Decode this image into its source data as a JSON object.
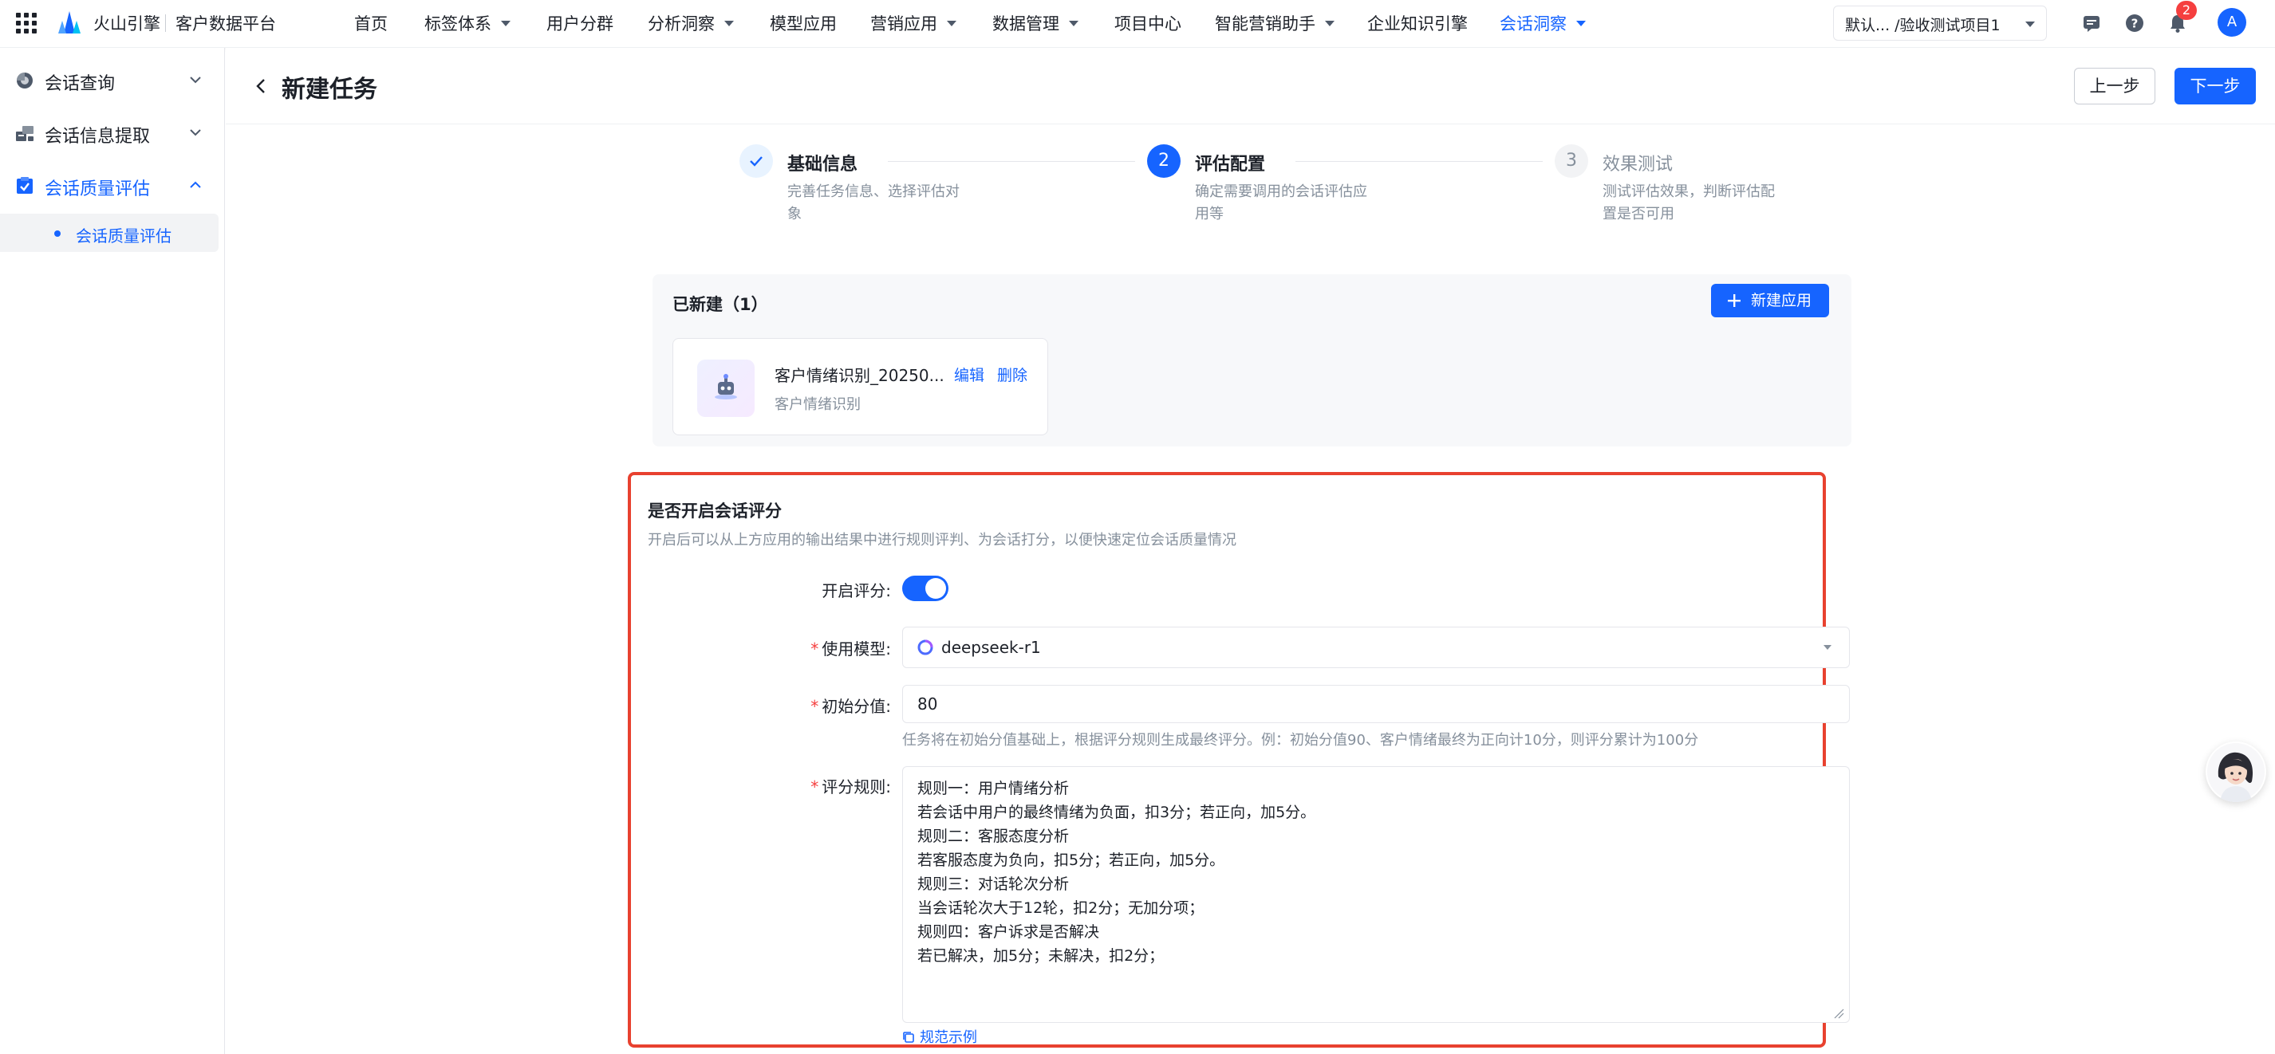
{
  "topnav": {
    "brand": "火山引擎",
    "platform": "客户数据平台",
    "items": [
      {
        "label": "首页",
        "has_caret": false
      },
      {
        "label": "标签体系",
        "has_caret": true
      },
      {
        "label": "用户分群",
        "has_caret": false
      },
      {
        "label": "分析洞察",
        "has_caret": true
      },
      {
        "label": "模型应用",
        "has_caret": false
      },
      {
        "label": "营销应用",
        "has_caret": true
      },
      {
        "label": "数据管理",
        "has_caret": true
      },
      {
        "label": "项目中心",
        "has_caret": false
      },
      {
        "label": "智能营销助手",
        "has_caret": true
      },
      {
        "label": "企业知识引擎",
        "has_caret": false
      },
      {
        "label": "会话洞察",
        "has_caret": true,
        "active": true
      }
    ],
    "project": "默认...   /验收测试项目1",
    "notification_count": "2",
    "avatar_initial": "A"
  },
  "sidebar": {
    "groups": [
      {
        "label": "会话查询",
        "expanded": false
      },
      {
        "label": "会话信息提取",
        "expanded": false
      },
      {
        "label": "会话质量评估",
        "expanded": true,
        "active": true
      }
    ],
    "sub_item": "会话质量评估"
  },
  "header": {
    "title": "新建任务",
    "prev_label": "上一步",
    "next_label": "下一步"
  },
  "steps": [
    {
      "number": "1",
      "state": "done",
      "title": "基础信息",
      "desc": "完善任务信息、选择评估对象"
    },
    {
      "number": "2",
      "state": "current",
      "title": "评估配置",
      "desc": "确定需要调用的会话评估应用等"
    },
    {
      "number": "3",
      "state": "pending",
      "title": "效果测试",
      "desc": "测试评估效果，判断评估配置是否可用"
    }
  ],
  "created": {
    "title": "已新建（1）",
    "new_app_label": "新建应用",
    "app": {
      "name": "客户情绪识别_20250...",
      "type": "客户情绪识别",
      "edit_label": "编辑",
      "delete_label": "删除"
    }
  },
  "scoring": {
    "title": "是否开启会话评分",
    "description": "开启后可以从上方应用的输出结果中进行规则评判、为会话打分，以便快速定位会话质量情况",
    "enable_label": "开启评分:",
    "enabled": true,
    "model_label": "使用模型:",
    "model_value": "deepseek-r1",
    "initial_label": "初始分值:",
    "initial_value": "80",
    "initial_hint": "任务将在初始分值基础上，根据评分规则生成最终评分。例：初始分值90、客户情绪最终为正向计10分，则评分累计为100分",
    "rules_label": "评分规则:",
    "rules": [
      "规则一：用户情绪分析",
      "若会话中用户的最终情绪为负面，扣3分；若正向，加5分。",
      "规则二：客服态度分析",
      "若客服态度为负向，扣5分；若正向，加5分。",
      "规则三：对话轮次分析",
      "当会话轮次大于12轮，扣2分；无加分项；",
      "规则四：客户诉求是否解决",
      "若已解决，加5分；未解决，扣2分；"
    ],
    "example_link": "规范示例"
  },
  "colors": {
    "primary": "#1664ff",
    "highlight_border": "#e8412f",
    "danger": "#f53f3f"
  }
}
